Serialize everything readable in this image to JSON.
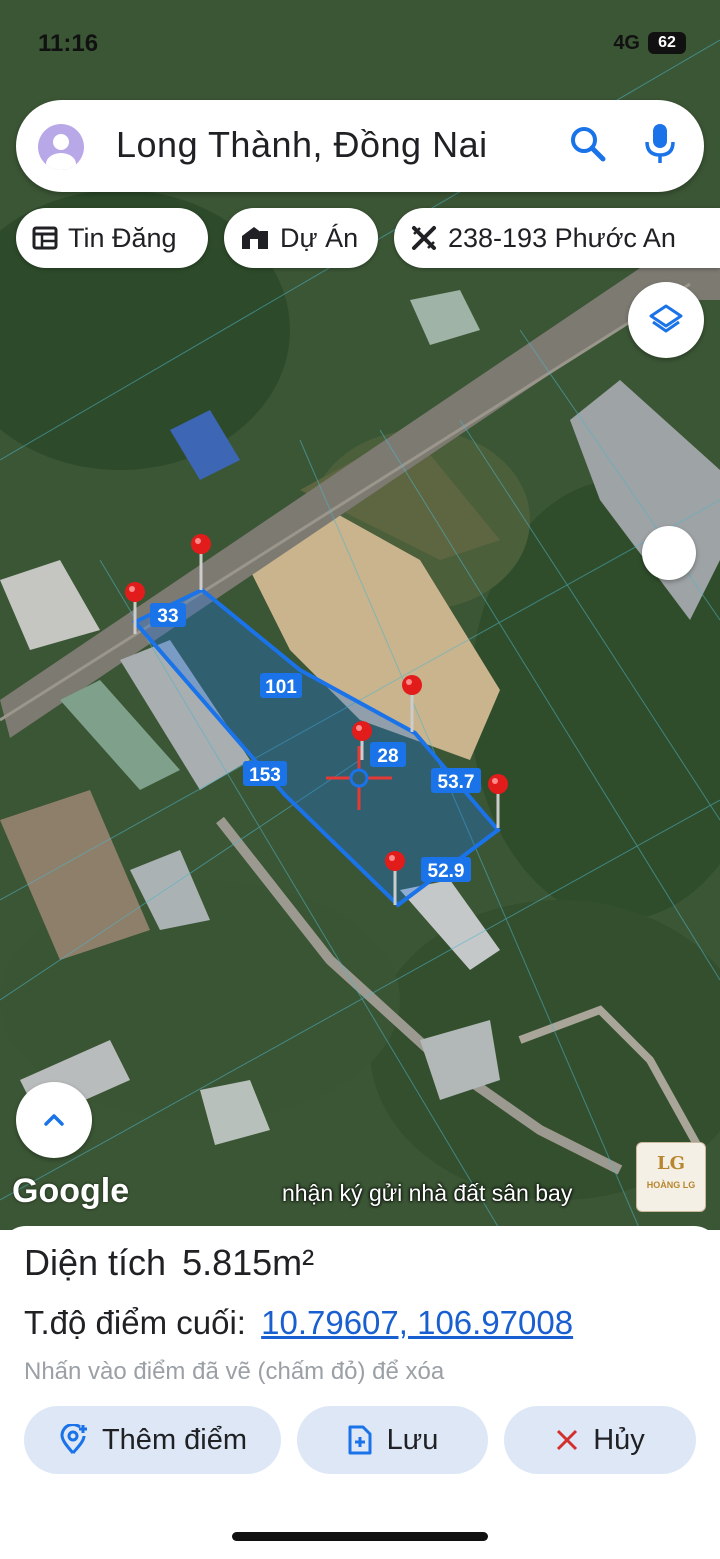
{
  "status": {
    "time": "11:16",
    "network": "4G",
    "battery": "62"
  },
  "search": {
    "text": "Long Thành, Đồng Nai",
    "search_icon": "search-icon",
    "mic_icon": "mic-icon",
    "avatar_icon": "user-avatar-icon"
  },
  "chips": [
    {
      "label": "Tin Đăng",
      "icon": "listing-icon"
    },
    {
      "label": "Dự Án",
      "icon": "project-building-icon"
    },
    {
      "label": "238-193 Phước An",
      "icon": "parcel-icon"
    }
  ],
  "map": {
    "segment_labels": [
      "33",
      "101",
      "28",
      "153",
      "53.7",
      "52.9"
    ],
    "google_logo": "Google",
    "caption": "nhận ký gửi nhà đất sân bay",
    "brand_mark": "LG",
    "brand_name": "HOÀNG LG",
    "parcel_color": "#1a73e8",
    "pin_color": "#e21b1b"
  },
  "sheet": {
    "area_label": "Diện tích",
    "area_value": "5.815m²",
    "coords_label": "T.độ điểm cuối:",
    "coords_value": "10.79607, 106.97008",
    "hint": "Nhấn vào điểm đã vẽ (chấm đỏ) để xóa",
    "buttons": {
      "add": "Thêm điểm",
      "save": "Lưu",
      "cancel": "Hủy"
    }
  }
}
